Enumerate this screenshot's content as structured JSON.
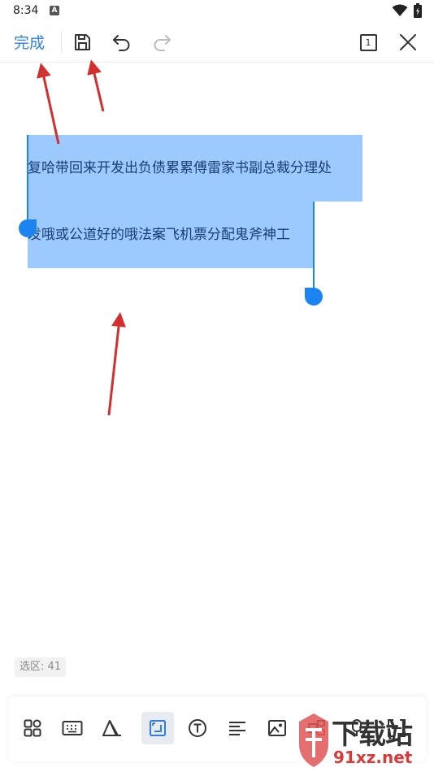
{
  "status_bar": {
    "time": "8:34",
    "notif_letter": "A"
  },
  "toolbar": {
    "done_label": "完成",
    "page_count": "1"
  },
  "selected_text": {
    "line1": "复哈带回来开发出负债累累傅雷家书副总裁分理处",
    "line2": "发哦或公道好的哦法案飞机票分配鬼斧神工"
  },
  "selection_status": "选区: 41",
  "tools": [
    {
      "name": "grid-apps",
      "active": false
    },
    {
      "name": "keyboard",
      "active": false
    },
    {
      "name": "shape",
      "active": false
    },
    {
      "name": "selection",
      "active": true
    },
    {
      "name": "text",
      "active": false
    },
    {
      "name": "align",
      "active": false
    },
    {
      "name": "image",
      "active": false
    },
    {
      "name": "layout",
      "active": false
    },
    {
      "name": "microphone",
      "active": false
    },
    {
      "name": "scan",
      "active": false
    }
  ],
  "watermark": {
    "brand": "下载站",
    "url": "91xz.net"
  },
  "colors": {
    "accent": "#2f7fe0",
    "selection_fill": "#9ccaff",
    "handle": "#1b84f0",
    "annotation_arrow": "#d32f2f"
  }
}
